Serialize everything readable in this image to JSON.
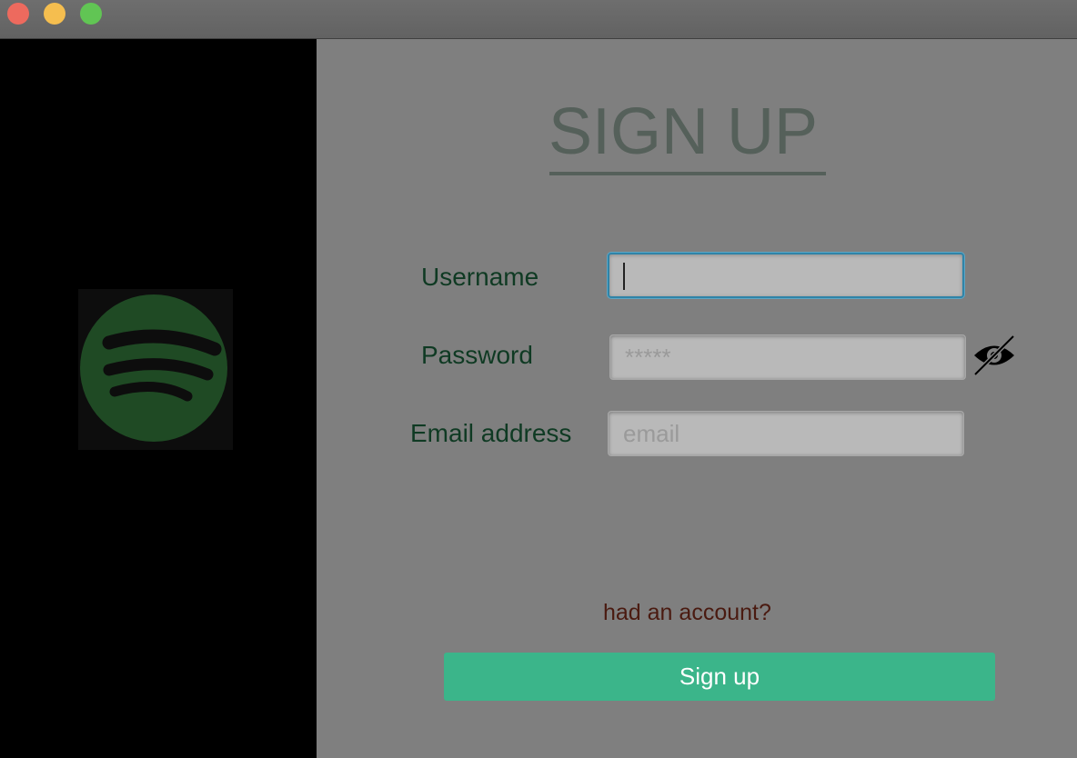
{
  "window": {
    "controls": [
      "close",
      "minimize",
      "maximize"
    ]
  },
  "logo": {
    "icon": "spotify-logo",
    "color": "#1f4a24"
  },
  "form": {
    "title": "SIGN UP",
    "username": {
      "label": "Username",
      "value": "",
      "placeholder": ""
    },
    "password": {
      "label": "Password",
      "value": "",
      "placeholder": "*****"
    },
    "email": {
      "label": "Email address",
      "value": "",
      "placeholder": "email"
    },
    "had_account_link": "had an account?",
    "submit_label": "Sign up"
  },
  "colors": {
    "accent": "#3bb58a",
    "label": "#0f3a23",
    "title": "#55605a",
    "link": "#4a1a10",
    "focus": "#2f84a8"
  }
}
